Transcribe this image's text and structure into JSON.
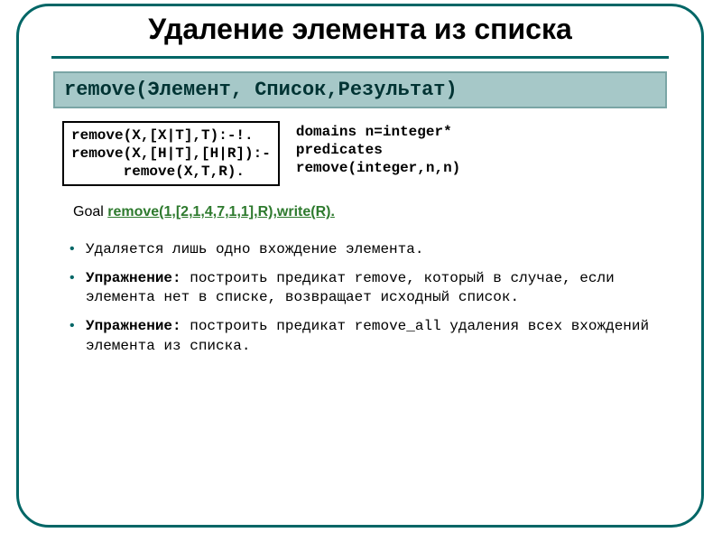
{
  "title": "Удаление элемента из списка",
  "signature": "remove(Элемент, Список,Результат)",
  "code_box": "remove(X,[X|T],T):-!.\nremove(X,[H|T],[H|R]):-\n      remove(X,T,R).",
  "declarations": "domains n=integer*\npredicates\nremove(integer,n,n)",
  "goal_label": "Goal ",
  "goal_code": "remove(1,[2,1,4,7,1,1],R),write(R).",
  "bullets": [
    {
      "plain": "Удаляется лишь одно вхождение элемента."
    },
    {
      "bold": "Упражнение:",
      "rest": " построить предикат remove, который в случае, если элемента нет в списке, возвращает исходный список."
    },
    {
      "bold": "Упражнение:",
      "rest": " построить предикат remove_all удаления всех вхождений элемента из списка."
    }
  ]
}
